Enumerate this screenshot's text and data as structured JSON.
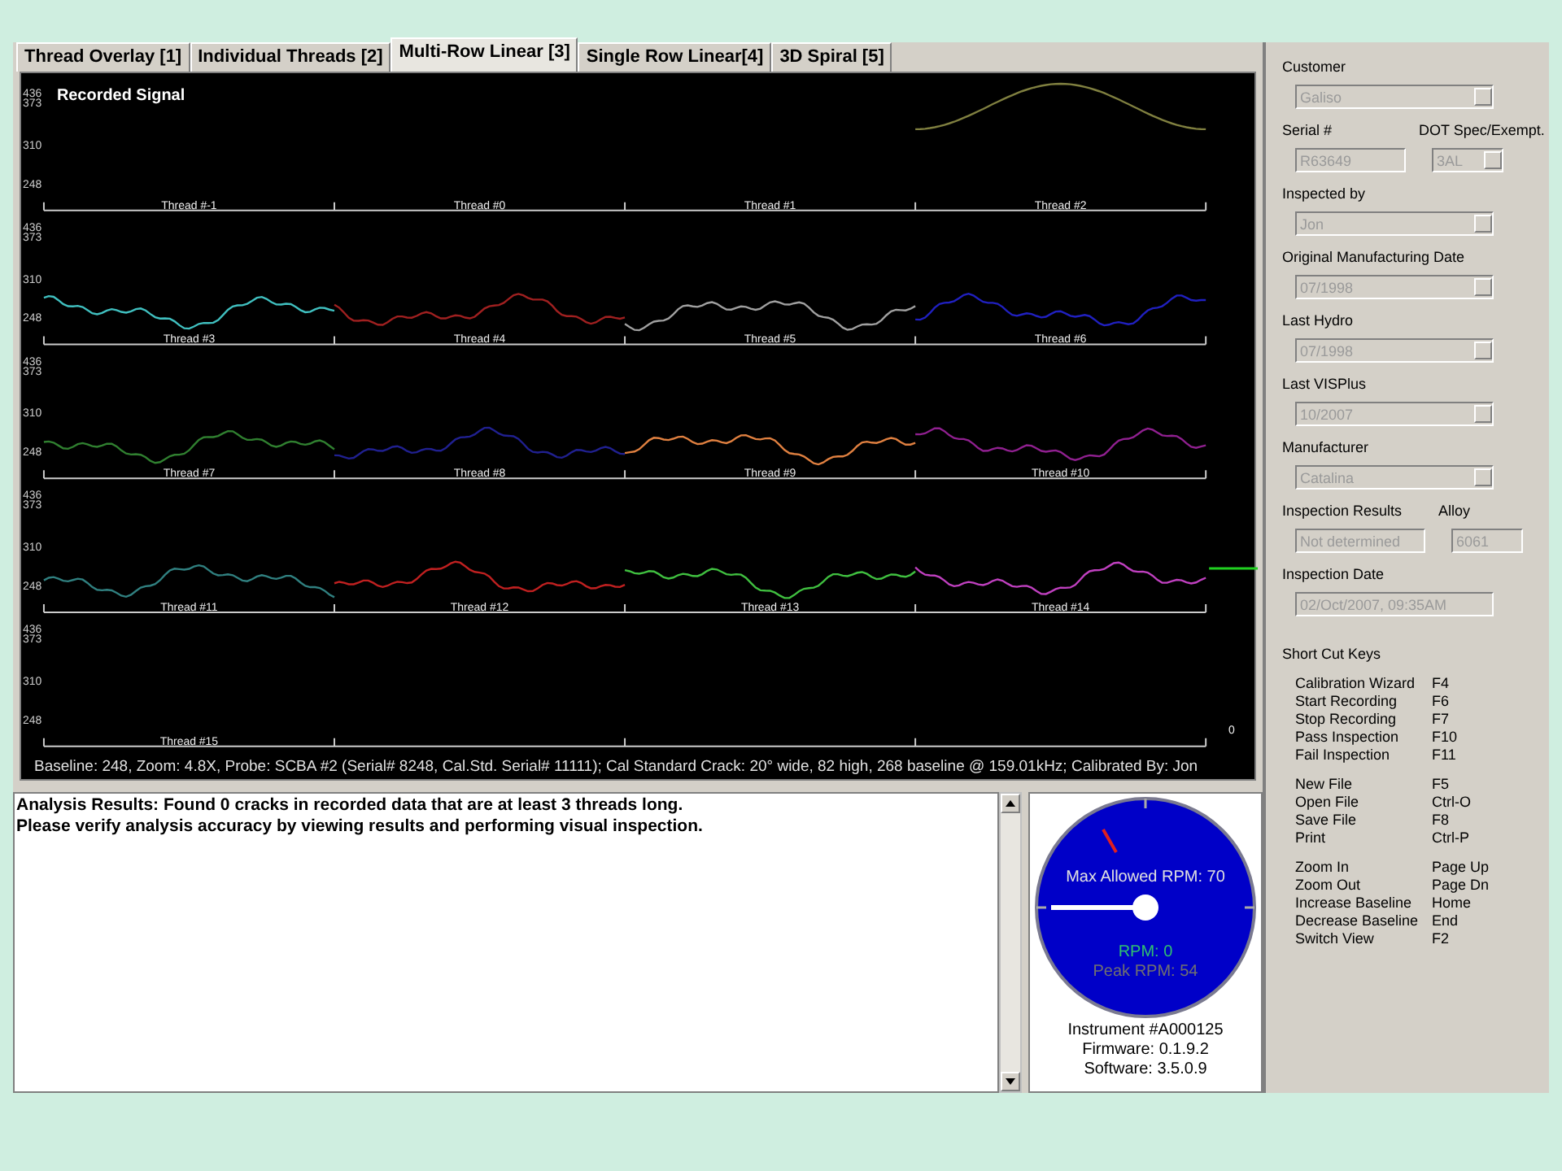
{
  "tabs": [
    {
      "label": "Thread Overlay [1]",
      "selected": false
    },
    {
      "label": "Individual Threads [2]",
      "selected": false
    },
    {
      "label": "Multi-Row Linear [3]",
      "selected": true
    },
    {
      "label": "Single Row Linear[4]",
      "selected": false
    },
    {
      "label": "3D Spiral [5]",
      "selected": false
    }
  ],
  "plot": {
    "title": "Recorded Signal",
    "rows": [
      {
        "ticks": [
          "436",
          "373",
          "310",
          "248"
        ],
        "threads": [
          {
            "label": "Thread #-1"
          },
          {
            "label": "Thread #0"
          },
          {
            "label": "Thread #1"
          },
          {
            "label": "Thread #2",
            "color": "#808040"
          }
        ]
      },
      {
        "ticks": [
          "436",
          "373",
          "310",
          "248"
        ],
        "threads": [
          {
            "label": "Thread #3",
            "color": "#40c0c0"
          },
          {
            "label": "Thread #4",
            "color": "#a02020"
          },
          {
            "label": "Thread #5",
            "color": "#a0a0a0"
          },
          {
            "label": "Thread #6",
            "color": "#2020c0"
          }
        ]
      },
      {
        "ticks": [
          "436",
          "373",
          "310",
          "248"
        ],
        "threads": [
          {
            "label": "Thread #7",
            "color": "#308030"
          },
          {
            "label": "Thread #8",
            "color": "#202090"
          },
          {
            "label": "Thread #9",
            "color": "#e08040"
          },
          {
            "label": "Thread #10",
            "color": "#902090"
          }
        ]
      },
      {
        "ticks": [
          "436",
          "373",
          "310",
          "248"
        ],
        "threads": [
          {
            "label": "Thread #11",
            "color": "#308080"
          },
          {
            "label": "Thread #12",
            "color": "#c02020"
          },
          {
            "label": "Thread #13",
            "color": "#40c040"
          },
          {
            "label": "Thread #14",
            "color": "#c040c0"
          }
        ]
      },
      {
        "ticks": [
          "436",
          "373",
          "310",
          "248"
        ],
        "threads": [
          {
            "label": "Thread #15"
          }
        ]
      }
    ],
    "end_reading": "0",
    "status": "Baseline: 248, Zoom: 4.8X, Probe: SCBA #2 (Serial# 8248, Cal.Std. Serial# 11111); Cal Standard Crack: 20° wide, 82 high, 268 baseline @ 159.01kHz; Calibrated By: Jon"
  },
  "analysis": [
    "Analysis Results: Found 0 cracks in recorded data that are at least 3 threads long.",
    "Please verify analysis accuracy by viewing results and performing visual inspection."
  ],
  "gauge": {
    "max_allowed": "Max Allowed RPM: 70",
    "rpm": "RPM: 0",
    "peak": "Peak RPM: 54",
    "info": [
      "Instrument #A000125",
      "Firmware: 0.1.9.2",
      "Software: 3.5.0.9"
    ]
  },
  "form": [
    [
      {
        "label": "Customer",
        "value": "Galiso",
        "kind": "dropdown",
        "disabled": true
      }
    ],
    [
      {
        "label": "Serial #",
        "value": "R63649",
        "kind": "text",
        "disabled": true
      },
      {
        "label": "DOT Spec/Exempt.",
        "value": "3AL",
        "kind": "dropdown",
        "disabled": true
      }
    ],
    [
      {
        "label": "Inspected by",
        "value": "Jon",
        "kind": "dropdown",
        "disabled": true
      }
    ],
    [
      {
        "label": "Original Manufacturing Date",
        "value": "07/1998",
        "kind": "dropdown",
        "disabled": true
      }
    ],
    [
      {
        "label": "Last Hydro",
        "value": "07/1998",
        "kind": "dropdown",
        "disabled": true
      }
    ],
    [
      {
        "label": "Last VISPlus",
        "value": "10/2007",
        "kind": "dropdown",
        "disabled": true
      }
    ],
    [
      {
        "label": "Manufacturer",
        "value": "Catalina",
        "kind": "dropdown",
        "disabled": true
      }
    ],
    [
      {
        "label": "Inspection Results",
        "value": "Not determined",
        "kind": "text",
        "disabled": true
      },
      {
        "label": "Alloy",
        "value": "6061",
        "kind": "text",
        "disabled": true
      }
    ],
    [
      {
        "label": "Inspection Date",
        "value": "02/Oct/2007, 09:35AM",
        "kind": "text",
        "disabled": true
      }
    ]
  ],
  "shortcuts": {
    "title": "Short Cut Keys",
    "groups": [
      [
        {
          "action": "Calibration Wizard",
          "key": "F4"
        },
        {
          "action": "Start Recording",
          "key": "F6"
        },
        {
          "action": "Stop Recording",
          "key": "F7"
        },
        {
          "action": "Pass Inspection",
          "key": "F10"
        },
        {
          "action": "Fail Inspection",
          "key": "F11"
        }
      ],
      [
        {
          "action": "New File",
          "key": "F5"
        },
        {
          "action": "Open File",
          "key": "Ctrl-O"
        },
        {
          "action": "Save File",
          "key": "F8"
        },
        {
          "action": "Print",
          "key": "Ctrl-P"
        }
      ],
      [
        {
          "action": "Zoom In",
          "key": "Page Up"
        },
        {
          "action": "Zoom Out",
          "key": "Page Dn"
        },
        {
          "action": "Increase Baseline",
          "key": "Home"
        },
        {
          "action": "Decrease Baseline",
          "key": "End"
        },
        {
          "action": "Switch View",
          "key": "F2"
        }
      ]
    ]
  }
}
